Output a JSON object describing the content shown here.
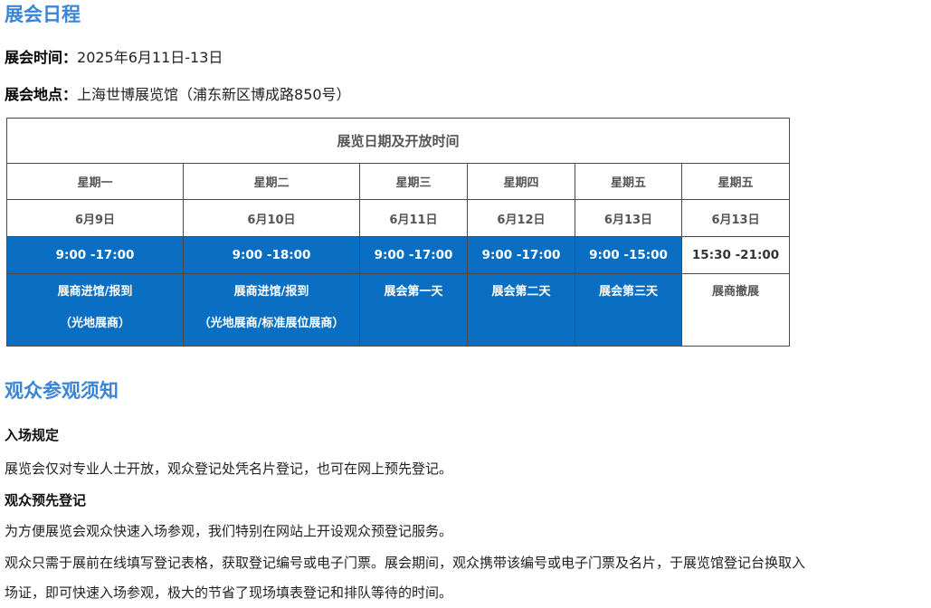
{
  "schedule": {
    "heading": "展会日程",
    "time_label": "展会时间：",
    "time_value": "2025年6月11日-13日",
    "venue_label": "展会地点：",
    "venue_value": "上海世博展览馆（浦东新区博成路850号）",
    "table": {
      "title": "展览日期及开放时间",
      "days": [
        "星期一",
        "星期二",
        "星期三",
        "星期四",
        "星期五",
        "星期五"
      ],
      "dates": [
        "6月9日",
        "6月10日",
        "6月11日",
        "6月12日",
        "6月13日",
        "6月13日"
      ],
      "times": [
        "9:00 -17:00",
        "9:00 -18:00",
        "9:00 -17:00",
        "9:00 -17:00",
        "9:00 -15:00",
        "15:30 -21:00"
      ],
      "activities": [
        {
          "line1": "展商进馆/报到",
          "line2": "（光地展商）"
        },
        {
          "line1": "展商进馆/报到",
          "line2": "（光地展商/标准展位展商）"
        },
        {
          "line1": "展会第一天",
          "line2": ""
        },
        {
          "line1": "展会第二天",
          "line2": ""
        },
        {
          "line1": "展会第三天",
          "line2": ""
        },
        {
          "line1": "展商撤展",
          "line2": ""
        }
      ],
      "highlight_color": "#0a6fc2"
    }
  },
  "notice": {
    "heading": "观众参观须知",
    "entry_title": "入场规定",
    "entry_text": "展览会仅对专业人士开放，观众登记处凭名片登记，也可在网上预先登记。",
    "prereg_title": "观众预先登记",
    "prereg_text1": "为方便展览会观众快速入场参观，我们特别在网站上开设观众预登记服务。",
    "prereg_text2a": "观众只需于展前在线填写登记表格，获取登记编号或电子门票。展会期间，观众携带该编号或电子门票及名片，于展览馆登记台换取入",
    "prereg_text2b": "场证，即可快速入场参观，极大的节省了现场填表登记和排队等待的时间。"
  }
}
